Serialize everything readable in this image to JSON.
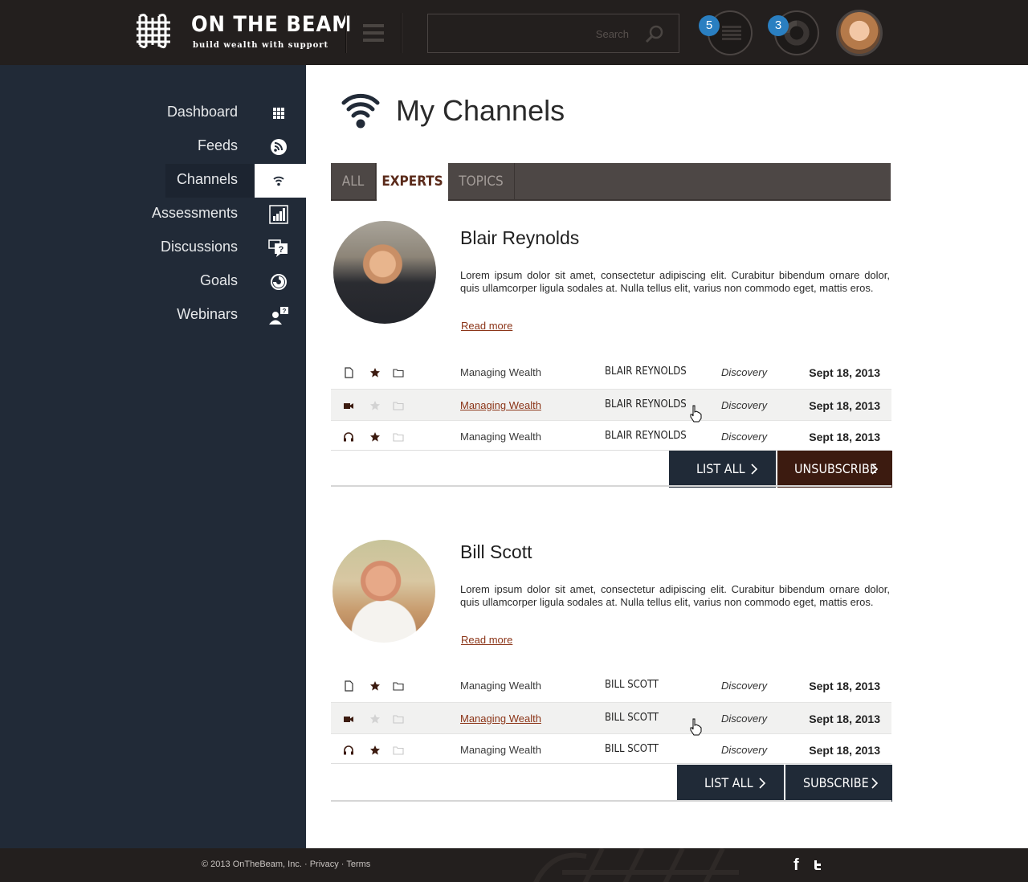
{
  "brand": {
    "title": "ON THE BEAM",
    "tagline": "build wealth with support"
  },
  "search": {
    "placeholder": "Search"
  },
  "header": {
    "list_badge": "5",
    "progress_badge": "3"
  },
  "sidebar": {
    "items": [
      {
        "label": "Dashboard",
        "icon": "grid-icon"
      },
      {
        "label": "Feeds",
        "icon": "rss-icon"
      },
      {
        "label": "Channels",
        "icon": "wifi-icon",
        "active": true
      },
      {
        "label": "Assessments",
        "icon": "bar-chart-icon"
      },
      {
        "label": "Discussions",
        "icon": "question-bubble-icon"
      },
      {
        "label": "Goals",
        "icon": "goal-ring-icon"
      },
      {
        "label": "Webinars",
        "icon": "presenter-icon"
      }
    ]
  },
  "main": {
    "title": "My Channels",
    "tabs": [
      "ALL",
      "EXPERTS",
      "TOPICS"
    ],
    "active_tab": "EXPERTS",
    "experts": [
      {
        "name": "Blair Reynolds",
        "bio": "Lorem ipsum dolor sit amet, consectetur adipiscing elit. Curabitur bibendum ornare dolor, quis ullamcorper ligula sodales at. Nulla tellus elit, varius non commodo eget, mattis eros.",
        "read_more": "Read more",
        "rows": [
          {
            "type_icon": "document-icon",
            "starred": true,
            "topic": "Managing Wealth",
            "author": "BLAIR REYNOLDS",
            "category": "Discovery",
            "date": "Sept 18, 2013"
          },
          {
            "type_icon": "video-icon",
            "starred": false,
            "topic": "Managing Wealth",
            "author": "BLAIR REYNOLDS",
            "category": "Discovery",
            "date": "Sept 18, 2013"
          },
          {
            "type_icon": "audio-icon",
            "starred": true,
            "topic": "Managing Wealth",
            "author": "BLAIR REYNOLDS",
            "category": "Discovery",
            "date": "Sept 18, 2013"
          }
        ],
        "list_all": "LIST ALL",
        "action": "UNSUBSCRIBE"
      },
      {
        "name": "Bill Scott",
        "bio": "Lorem ipsum dolor sit amet, consectetur adipiscing elit. Curabitur bibendum ornare dolor, quis ullamcorper ligula sodales at. Nulla tellus elit, varius non commodo eget, mattis eros.",
        "read_more": "Read more",
        "rows": [
          {
            "type_icon": "document-icon",
            "starred": true,
            "topic": "Managing Wealth",
            "author": "BILL SCOTT",
            "category": "Discovery",
            "date": "Sept 18, 2013"
          },
          {
            "type_icon": "video-icon",
            "starred": false,
            "topic": "Managing Wealth",
            "author": "BILL SCOTT",
            "category": "Discovery",
            "date": "Sept 18, 2013"
          },
          {
            "type_icon": "audio-icon",
            "starred": true,
            "topic": "Managing Wealth",
            "author": "BILL SCOTT",
            "category": "Discovery",
            "date": "Sept 18, 2013"
          }
        ],
        "list_all": "LIST ALL",
        "action": "SUBSCRIBE"
      }
    ]
  },
  "footer": {
    "copyright": "© 2013 OnTheBeam, Inc.",
    "privacy": "Privacy",
    "terms": "Terms",
    "separator": " · "
  },
  "colors": {
    "topbar": "#231f1e",
    "sidebar": "#212a37",
    "accent_brown": "#3c1b10",
    "link": "#8b3417",
    "badge": "#2a7fc1"
  }
}
